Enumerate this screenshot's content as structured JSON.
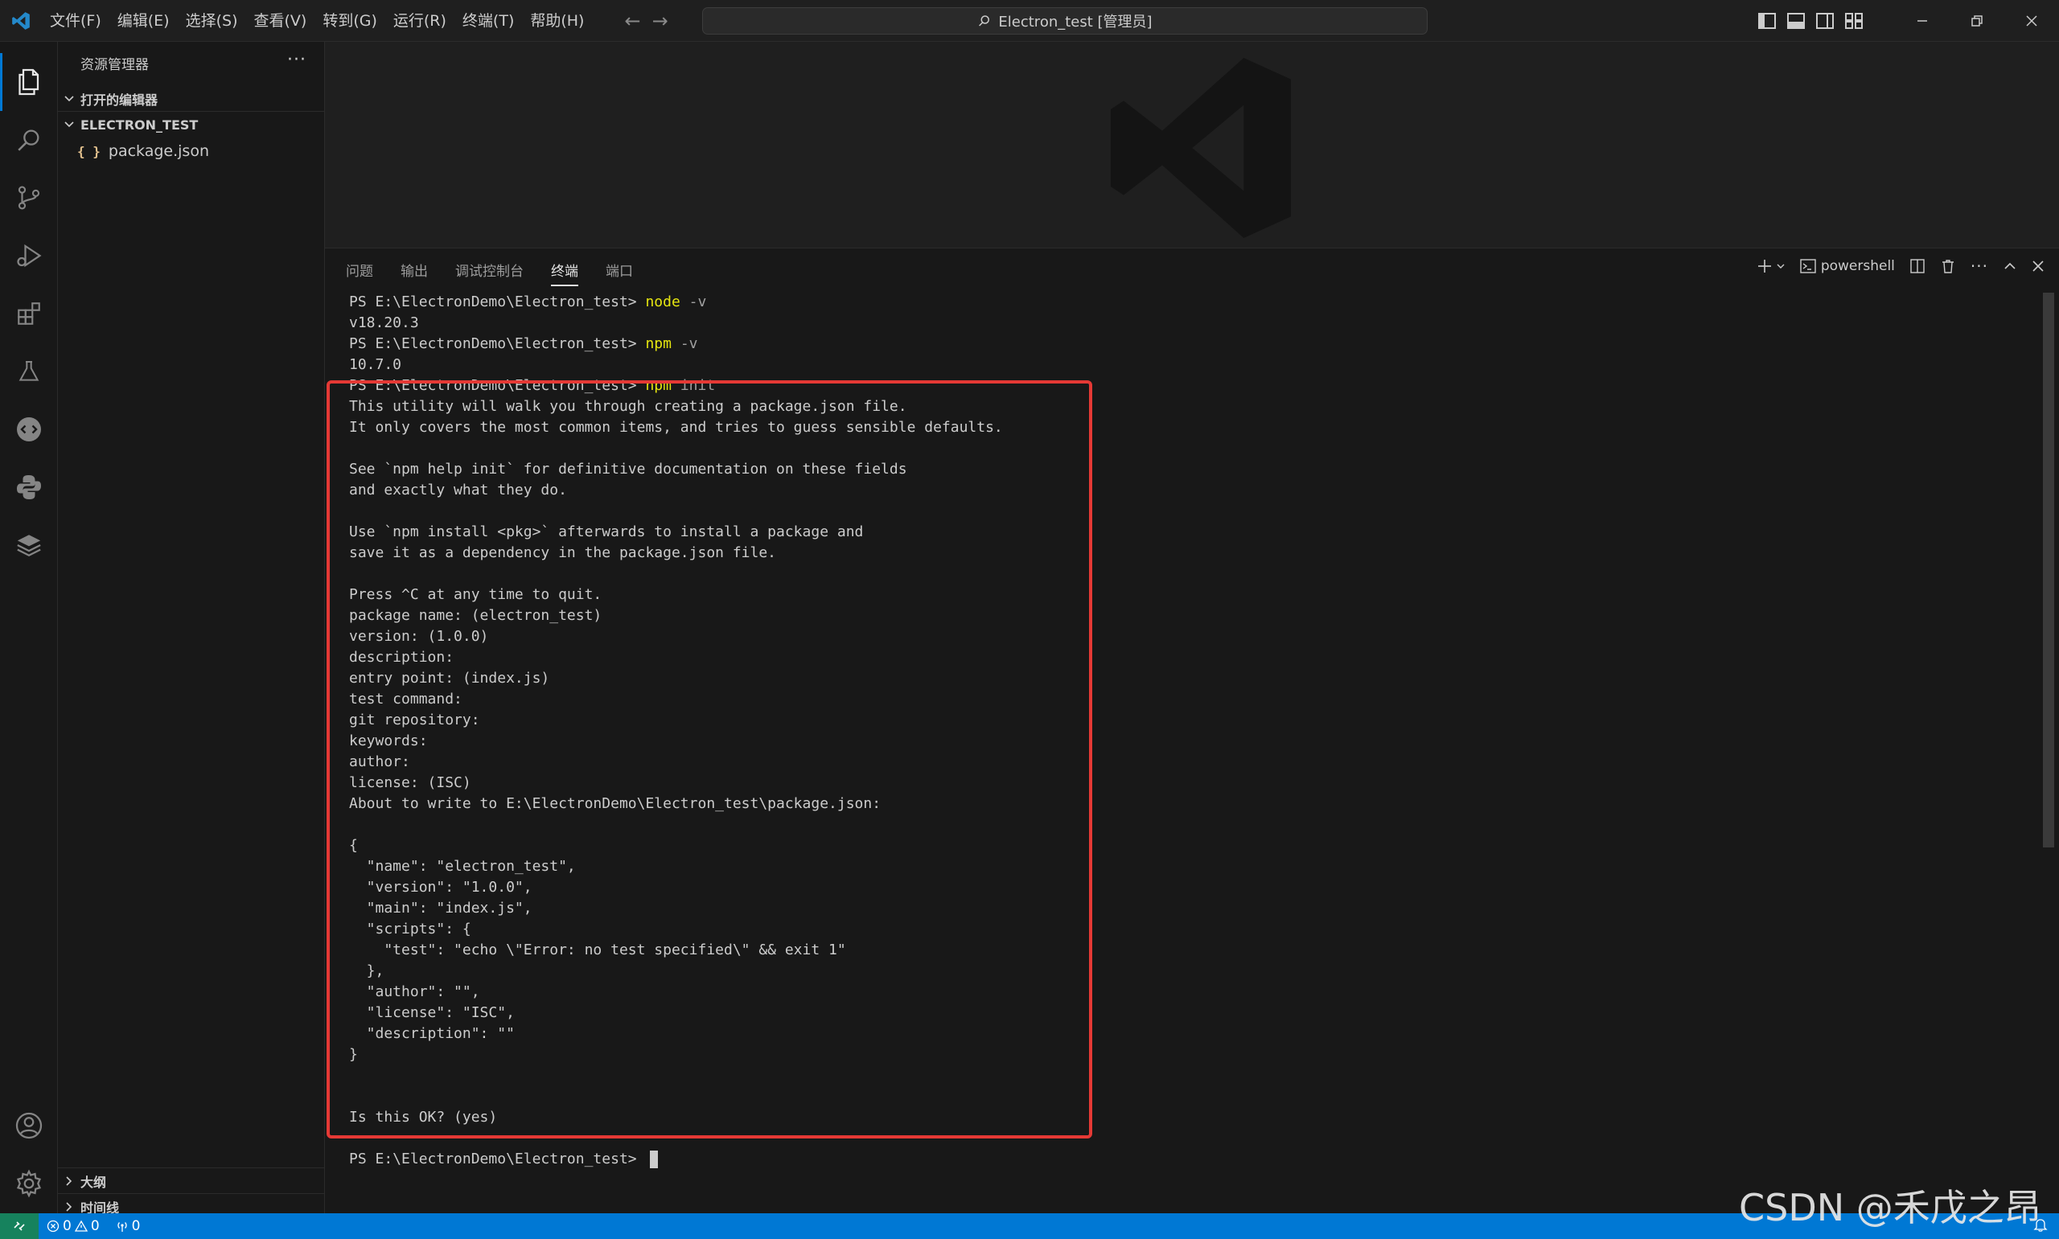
{
  "titlebar": {
    "menu": [
      "文件(F)",
      "编辑(E)",
      "选择(S)",
      "查看(V)",
      "转到(G)",
      "运行(R)",
      "终端(T)",
      "帮助(H)"
    ],
    "search_text": "Electron_test [管理员]"
  },
  "sidebar": {
    "header": "资源管理器",
    "open_editors": "打开的编辑器",
    "folder": "ELECTRON_TEST",
    "file": "package.json",
    "outline": "大纲",
    "timeline": "时间线"
  },
  "panel": {
    "tabs": [
      "问题",
      "输出",
      "调试控制台",
      "终端",
      "端口"
    ],
    "active_tab": "终端",
    "terminal_name": "powershell"
  },
  "terminal": {
    "lines": [
      {
        "prompt": "PS E:\\ElectronDemo\\Electron_test> ",
        "cmd": "node",
        "arg": " -v"
      },
      {
        "text": "v18.20.3"
      },
      {
        "prompt": "PS E:\\ElectronDemo\\Electron_test> ",
        "cmd": "npm",
        "arg": " -v"
      },
      {
        "text": "10.7.0"
      },
      {
        "prompt": "PS E:\\ElectronDemo\\Electron_test> ",
        "cmd": "npm",
        "arg": " init"
      },
      {
        "text": "This utility will walk you through creating a package.json file."
      },
      {
        "text": "It only covers the most common items, and tries to guess sensible defaults."
      },
      {
        "text": ""
      },
      {
        "text": "See `npm help init` for definitive documentation on these fields"
      },
      {
        "text": "and exactly what they do."
      },
      {
        "text": ""
      },
      {
        "text": "Use `npm install <pkg>` afterwards to install a package and"
      },
      {
        "text": "save it as a dependency in the package.json file."
      },
      {
        "text": ""
      },
      {
        "text": "Press ^C at any time to quit."
      },
      {
        "text": "package name: (electron_test)"
      },
      {
        "text": "version: (1.0.0)"
      },
      {
        "text": "description:"
      },
      {
        "text": "entry point: (index.js)"
      },
      {
        "text": "test command:"
      },
      {
        "text": "git repository:"
      },
      {
        "text": "keywords:"
      },
      {
        "text": "author:"
      },
      {
        "text": "license: (ISC)"
      },
      {
        "text": "About to write to E:\\ElectronDemo\\Electron_test\\package.json:"
      },
      {
        "text": ""
      },
      {
        "text": "{"
      },
      {
        "text": "  \"name\": \"electron_test\","
      },
      {
        "text": "  \"version\": \"1.0.0\","
      },
      {
        "text": "  \"main\": \"index.js\","
      },
      {
        "text": "  \"scripts\": {"
      },
      {
        "text": "    \"test\": \"echo \\\"Error: no test specified\\\" && exit 1\""
      },
      {
        "text": "  },"
      },
      {
        "text": "  \"author\": \"\","
      },
      {
        "text": "  \"license\": \"ISC\","
      },
      {
        "text": "  \"description\": \"\""
      },
      {
        "text": "}"
      },
      {
        "text": ""
      },
      {
        "text": ""
      },
      {
        "text": "Is this OK? (yes)"
      },
      {
        "text": ""
      },
      {
        "prompt": "PS E:\\ElectronDemo\\Electron_test> ",
        "cursor": true
      }
    ]
  },
  "statusbar": {
    "errors": "0",
    "warnings": "0",
    "ports": "0"
  },
  "watermark": "CSDN @禾戊之昂",
  "colors": {
    "accent": "#0078d4",
    "highlight": "#e53935",
    "command": "#e5e510"
  }
}
